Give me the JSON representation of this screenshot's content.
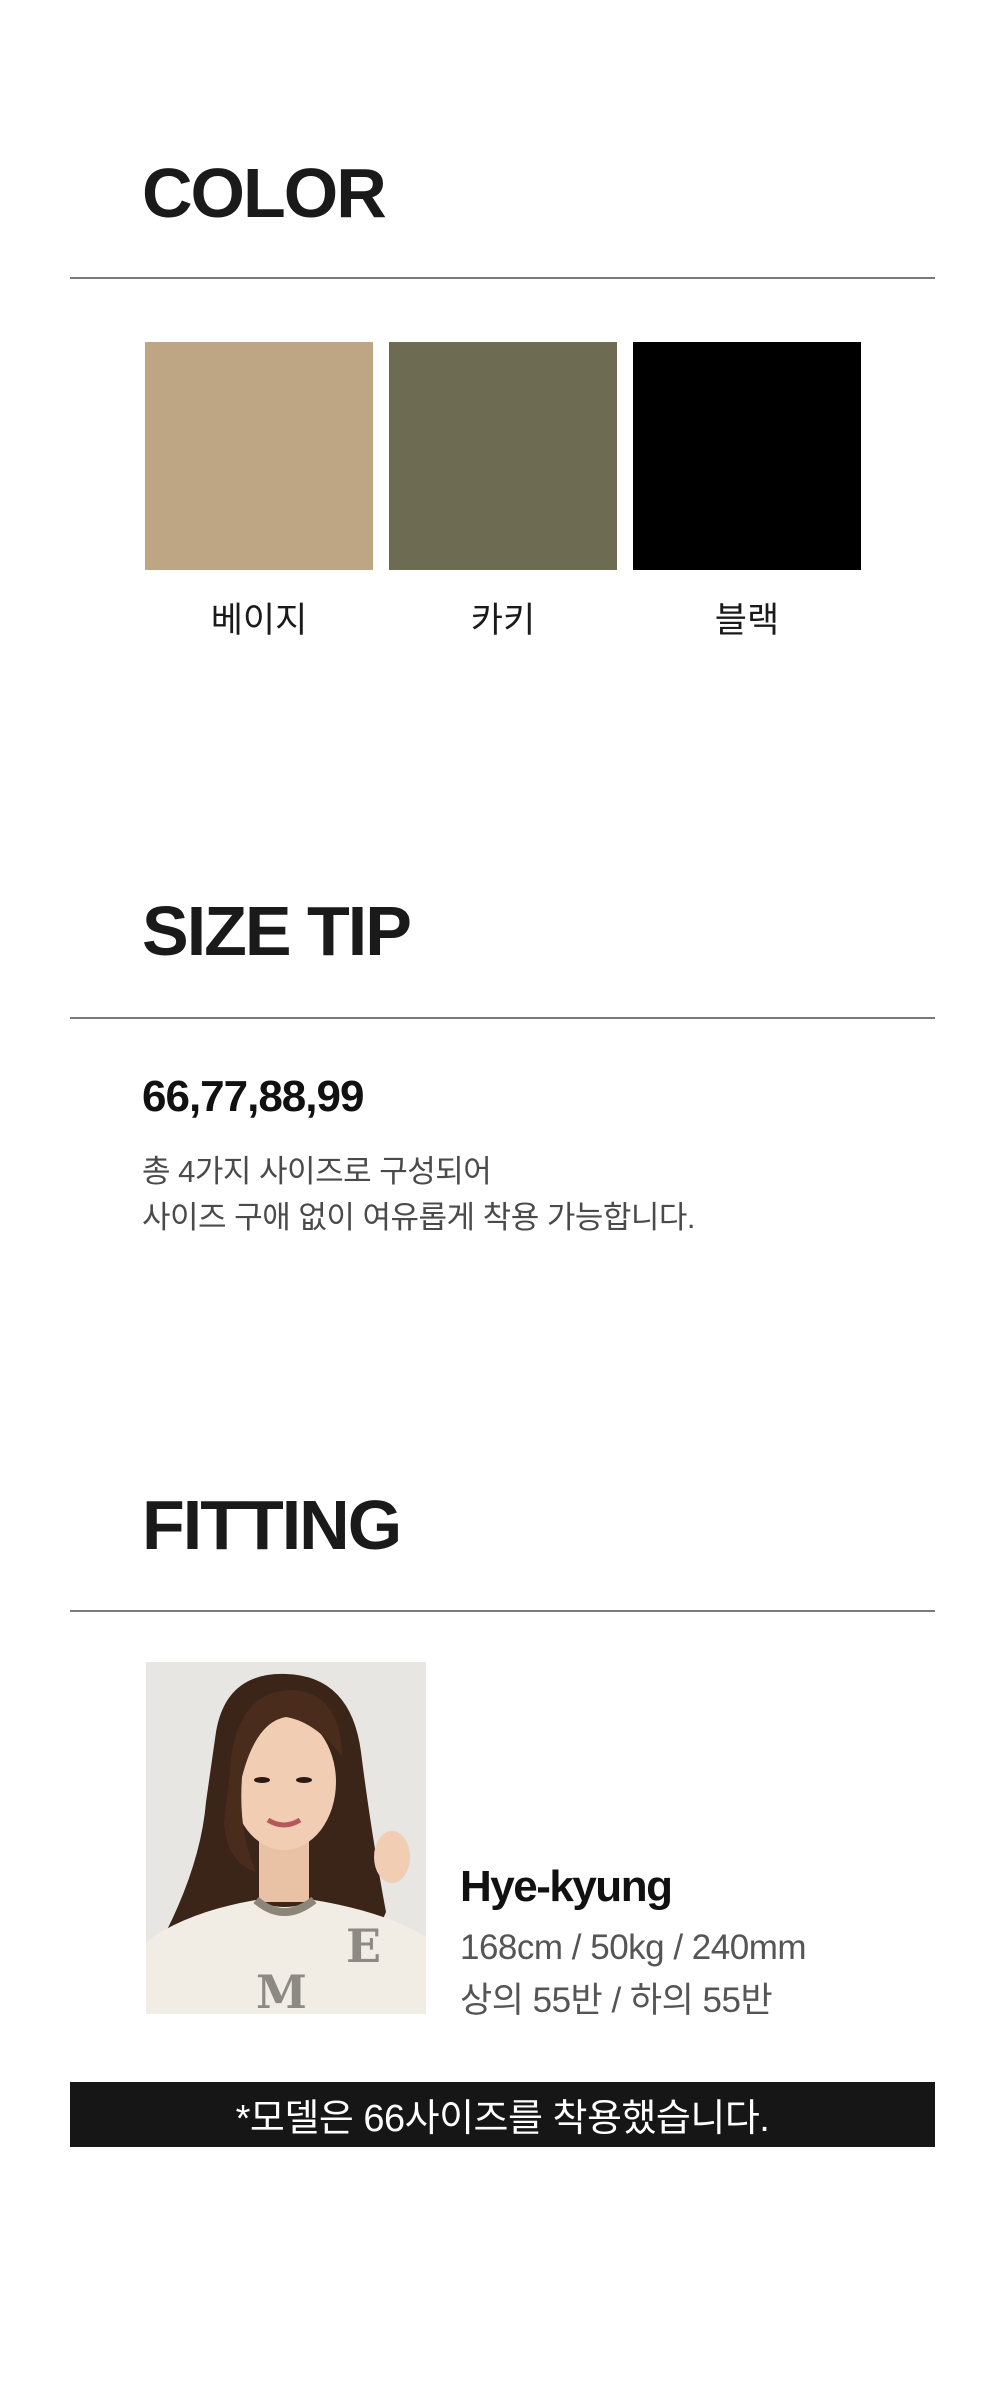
{
  "color_section": {
    "title": "COLOR",
    "swatches": [
      {
        "label": "베이지",
        "color": "#bea685"
      },
      {
        "label": "카키",
        "color": "#6d6b51"
      },
      {
        "label": "블랙",
        "color": "#000000"
      }
    ]
  },
  "size_section": {
    "title": "SIZE TIP",
    "sizes": "66,77,88,99",
    "description_line1": "총 4가지 사이즈로 구성되어",
    "description_line2": "사이즈 구애 없이 여유롭게 착용 가능합니다."
  },
  "fitting_section": {
    "title": "FITTING",
    "model": {
      "name": "Hye-kyung",
      "measurements": "168cm / 50kg / 240mm",
      "sizes_worn": "상의 55반 / 하의 55반"
    },
    "notice": "*모델은 66사이즈를 착용했습니다."
  }
}
